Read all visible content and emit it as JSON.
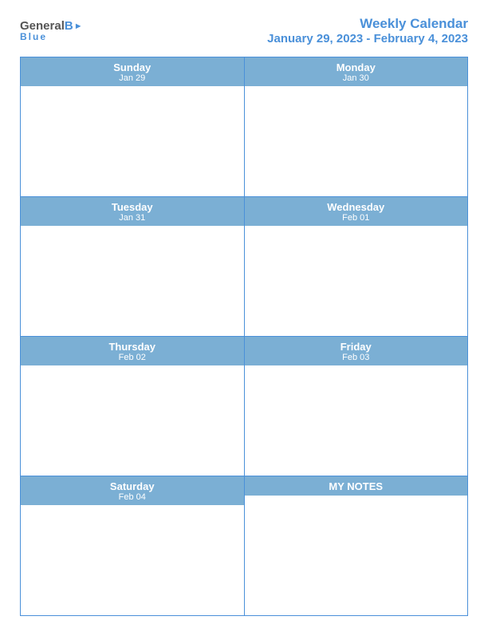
{
  "header": {
    "logo": {
      "general": "General",
      "blue": "Blue",
      "flag_symbol": "▶"
    },
    "title": "Weekly Calendar",
    "date_range": "January 29, 2023 - February 4, 2023"
  },
  "calendar": {
    "rows": [
      {
        "cells": [
          {
            "day": "Sunday",
            "date": "Jan 29"
          },
          {
            "day": "Monday",
            "date": "Jan 30"
          }
        ]
      },
      {
        "cells": [
          {
            "day": "Tuesday",
            "date": "Jan 31"
          },
          {
            "day": "Wednesday",
            "date": "Feb 01"
          }
        ]
      },
      {
        "cells": [
          {
            "day": "Thursday",
            "date": "Feb 02"
          },
          {
            "day": "Friday",
            "date": "Feb 03"
          }
        ]
      },
      {
        "cells": [
          {
            "day": "Saturday",
            "date": "Feb 04"
          },
          {
            "day": "MY NOTES",
            "date": ""
          }
        ]
      }
    ]
  }
}
